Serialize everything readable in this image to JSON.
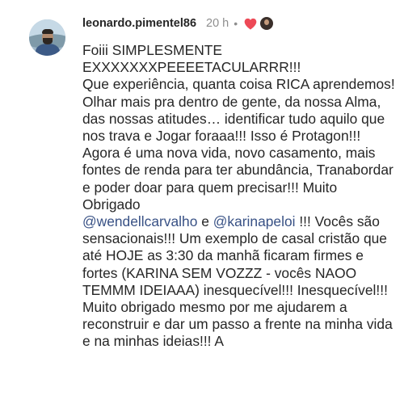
{
  "comment": {
    "username": "leonardo.pimentel86",
    "time": "20 h",
    "separator": "•",
    "icons": {
      "heart": "heart-icon",
      "reactor": "reactor-avatar"
    },
    "colors": {
      "heart": "#ed4956",
      "mention": "#385185",
      "meta": "#8e8e8e",
      "text": "#262626"
    },
    "text_part1": "Foiii SIMPLESMENTE\nEXXXXXXXPEEEETACULARRR!!!\nQue experiência, quanta coisa RICA aprendemos! Olhar mais pra dentro de gente, da nossa Alma, das nossas atitudes… identificar tudo aquilo que nos trava e Jogar foraaa!!! Isso é Protagon!!! Agora é uma nova vida, novo casamento, mais fontes de renda para ter abundância, Tranabordar e poder doar para quem precisar!!! Muito Obrigado\n",
    "mention1": "@wendellcarvalho",
    "text_part2": " e ",
    "mention2": "@karinapeloi",
    "text_part3": " !!! Vocês são sensacionais!!! Um exemplo de casal cristão que até HOJE as 3:30 da manhã ficaram firmes e fortes (KARINA SEM VOZZZ - vocês NAOO TEMMM IDEIAAA) inesquecível!!! Inesquecível!!! Muito obrigado mesmo por me ajudarem a reconstruir e dar um passo a frente na minha vida e na minhas ideias!!! A"
  }
}
